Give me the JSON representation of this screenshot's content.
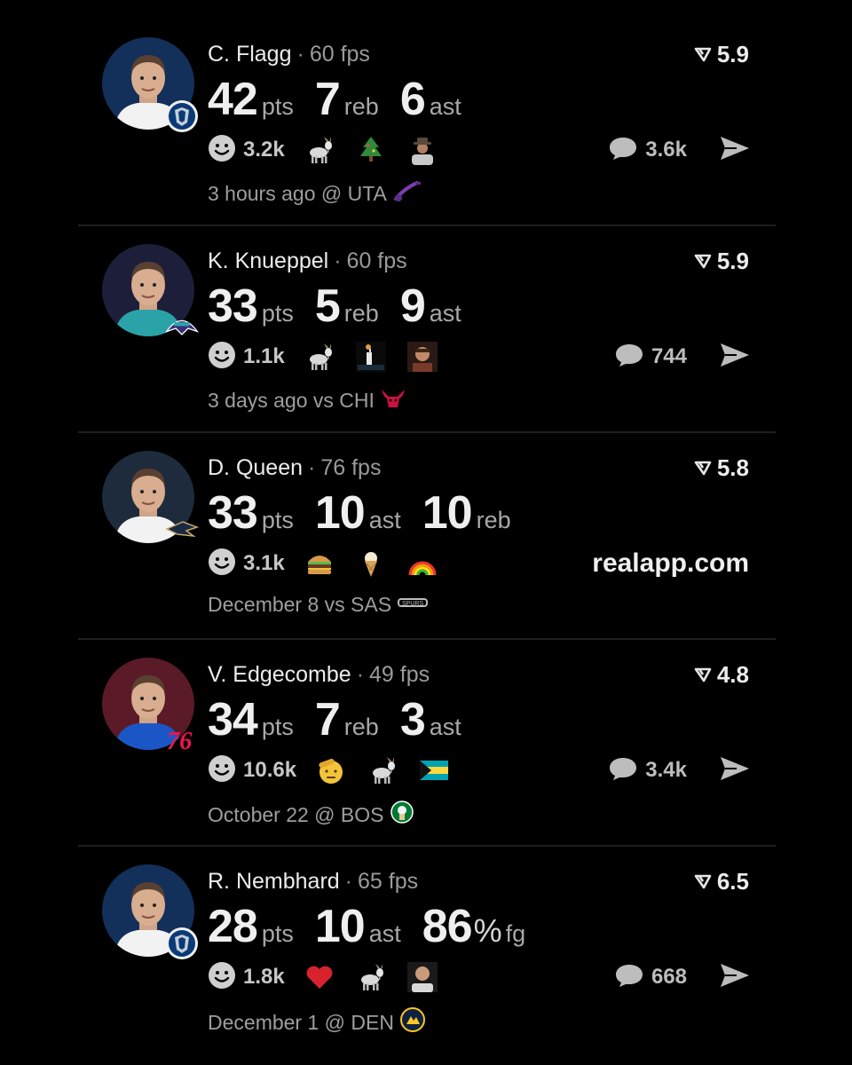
{
  "posts": [
    {
      "name": "C. Flagg",
      "separator": "·",
      "fps": "60 fps",
      "rating": "5.9",
      "stats": [
        {
          "value": "42",
          "unit": "pts"
        },
        {
          "value": "7",
          "unit": "reb"
        },
        {
          "value": "6",
          "unit": "ast"
        }
      ],
      "reaction_count": "3.2k",
      "emojis": [
        "goat-icon",
        "tree-icon",
        "cowboy-person-icon"
      ],
      "comment_count": "3.6k",
      "footer": "3 hours ago @ UTA",
      "team": "DAL",
      "opponent": "UTA",
      "colors": {
        "avatar_bg": "#13305a",
        "jersey": "#f2f2f2",
        "logo": "#0a3a78"
      }
    },
    {
      "name": "K. Knueppel",
      "separator": "·",
      "fps": "60 fps",
      "rating": "5.9",
      "stats": [
        {
          "value": "33",
          "unit": "pts"
        },
        {
          "value": "5",
          "unit": "reb"
        },
        {
          "value": "9",
          "unit": "ast"
        }
      ],
      "reaction_count": "1.1k",
      "emojis": [
        "goat-icon",
        "shooter-icon",
        "face-photo-icon"
      ],
      "comment_count": "744",
      "footer": "3 days ago vs CHI",
      "team": "CHA",
      "opponent": "CHI",
      "colors": {
        "avatar_bg": "#1d1f3a",
        "jersey": "#2aa3a8",
        "logo": "#3b2d77"
      }
    },
    {
      "name": "D. Queen",
      "separator": "·",
      "fps": "76 fps",
      "rating": "5.8",
      "stats": [
        {
          "value": "33",
          "unit": "pts"
        },
        {
          "value": "10",
          "unit": "ast"
        },
        {
          "value": "10",
          "unit": "reb"
        }
      ],
      "reaction_count": "3.1k",
      "emojis": [
        "burger-icon",
        "ice-cream-icon",
        "rainbow-icon"
      ],
      "site": "realapp.com",
      "footer": "December 8 vs SAS",
      "team": "NOP",
      "opponent": "SAS",
      "colors": {
        "avatar_bg": "#1e2b3c",
        "jersey": "#f2f2f2",
        "logo": "#1a2a45"
      }
    },
    {
      "name": "V. Edgecombe",
      "separator": "·",
      "fps": "49 fps",
      "rating": "4.8",
      "stats": [
        {
          "value": "34",
          "unit": "pts"
        },
        {
          "value": "7",
          "unit": "reb"
        },
        {
          "value": "3",
          "unit": "ast"
        }
      ],
      "reaction_count": "10.6k",
      "emojis": [
        "saluting-face-icon",
        "goat-icon",
        "bahamas-flag-icon"
      ],
      "comment_count": "3.4k",
      "footer": "October 22 @ BOS",
      "team": "PHI",
      "team_text": "76",
      "opponent": "BOS",
      "colors": {
        "avatar_bg": "#5b1a28",
        "jersey": "#1b56c6",
        "logo": "#ed174c"
      }
    },
    {
      "name": "R. Nembhard",
      "separator": "·",
      "fps": "65 fps",
      "rating": "6.5",
      "stats": [
        {
          "value": "28",
          "unit": "pts"
        },
        {
          "value": "10",
          "unit": "ast"
        },
        {
          "value": "86",
          "pct": "%",
          "unit": "fg"
        }
      ],
      "reaction_count": "1.8k",
      "emojis": [
        "heart-icon",
        "goat-icon",
        "bald-man-icon"
      ],
      "comment_count": "668",
      "footer": "December 1 @ DEN",
      "team": "DAL",
      "opponent": "DEN",
      "colors": {
        "avatar_bg": "#13305a",
        "jersey": "#f2f2f2",
        "logo": "#0a3a78"
      }
    }
  ]
}
